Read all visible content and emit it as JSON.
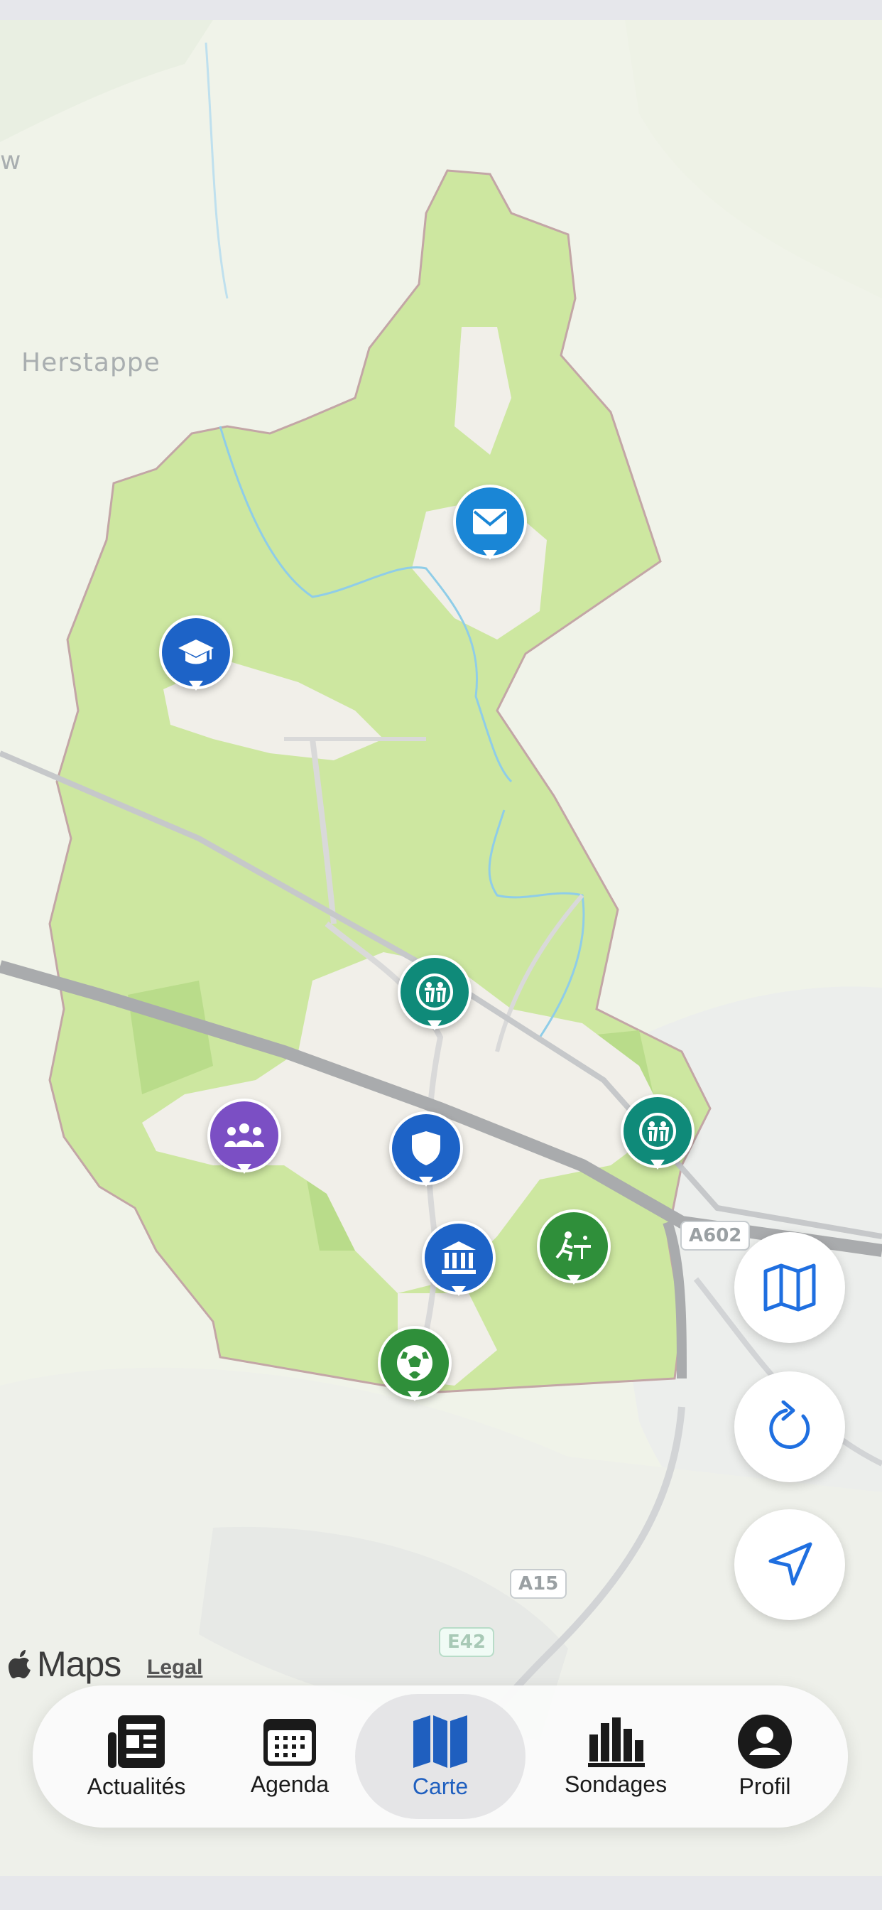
{
  "map": {
    "place_labels": [
      "Herstappe",
      "w"
    ],
    "road_shields": [
      "A602",
      "A15",
      "E42"
    ],
    "attribution": {
      "logo": "Maps",
      "legal": "Legal"
    },
    "pins": [
      {
        "name": "post-office-pin",
        "icon": "envelope-icon",
        "color": "#1a86d6"
      },
      {
        "name": "school-pin",
        "icon": "graduation-cap-icon",
        "color": "#1d63c7"
      },
      {
        "name": "playground-pin",
        "icon": "children-icon",
        "color": "#0f8a79"
      },
      {
        "name": "association-pin",
        "icon": "group-icon",
        "color": "#7b4fc4"
      },
      {
        "name": "police-pin",
        "icon": "shield-icon",
        "color": "#1d63c7"
      },
      {
        "name": "playground-pin-2",
        "icon": "children-icon",
        "color": "#0f8a79"
      },
      {
        "name": "town-hall-pin",
        "icon": "institution-icon",
        "color": "#1d63c7"
      },
      {
        "name": "sport-pin",
        "icon": "pingpong-icon",
        "color": "#2f8f3a"
      },
      {
        "name": "football-pin",
        "icon": "soccer-ball-icon",
        "color": "#2f8f3a"
      }
    ]
  },
  "controls": {
    "map_type_button": "map-layers-icon",
    "refresh_button": "refresh-icon",
    "locate_button": "location-arrow-icon",
    "accent": "#1f6fe0"
  },
  "tabs": [
    {
      "label": "Actualités",
      "icon": "newspaper-icon",
      "active": false
    },
    {
      "label": "Agenda",
      "icon": "calendar-icon",
      "active": false
    },
    {
      "label": "Carte",
      "icon": "map-icon",
      "active": true
    },
    {
      "label": "Sondages",
      "icon": "bar-chart-icon",
      "active": false
    },
    {
      "label": "Profil",
      "icon": "profile-icon",
      "active": false
    }
  ]
}
